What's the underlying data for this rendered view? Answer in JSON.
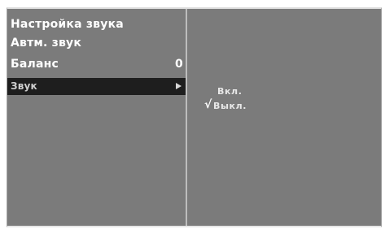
{
  "menu": {
    "items": [
      {
        "label": "Настройка звука",
        "value": ""
      },
      {
        "label": "Автм. звук",
        "value": ""
      },
      {
        "label": "Баланс",
        "value": "0"
      },
      {
        "label": "Звук",
        "value": ""
      }
    ],
    "selected_index": 3
  },
  "submenu": {
    "options": [
      {
        "label": "Вкл.",
        "checked": false
      },
      {
        "label": "Выкл.",
        "checked": true
      }
    ],
    "check_mark": "√"
  },
  "colors": {
    "panel_bg": "#7b7b7b",
    "highlight_bg": "#1e1e1e",
    "text": "#ffffff"
  }
}
